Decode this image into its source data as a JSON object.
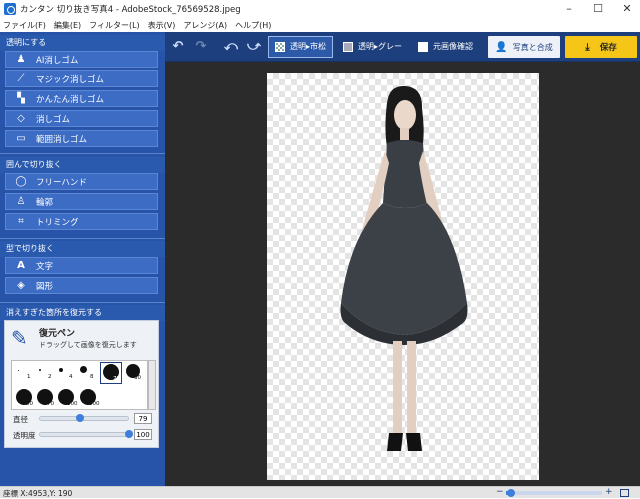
{
  "window": {
    "title": "カンタン 切り抜き写真4 - AdobeStock_76569528.jpeg",
    "minimize": "–",
    "maximize": "☐",
    "close": "✕"
  },
  "menu": [
    "ファイル(F)",
    "編集(E)",
    "フィルター(L)",
    "表示(V)",
    "アレンジ(A)",
    "ヘルプ(H)"
  ],
  "toolbar": {
    "undo": "↶",
    "redo": "↷",
    "rotate_left": "⤺",
    "rotate_right": "⤻",
    "modes": [
      {
        "label": "透明▸市松",
        "active": true
      },
      {
        "label": "透明▸グレー",
        "active": false
      },
      {
        "label": "元画像確認",
        "active": false
      }
    ],
    "compose_label": "写真と合成",
    "save_label": "保存"
  },
  "sidebar": {
    "transparent_header": "透明にする",
    "transparent_tools": [
      {
        "label": "AI消しゴム",
        "icon": "person-icon"
      },
      {
        "label": "マジック消しゴム",
        "icon": "magic-wand-icon"
      },
      {
        "label": "かんたん消しゴム",
        "icon": "easy-eraser-icon"
      },
      {
        "label": "消しゴム",
        "icon": "eraser-icon"
      },
      {
        "label": "範囲消しゴム",
        "icon": "rectangle-icon"
      }
    ],
    "enclose_header": "囲んで切り抜く",
    "enclose_tools": [
      {
        "label": "フリーハンド",
        "icon": "lasso-icon"
      },
      {
        "label": "輪郭",
        "icon": "person-outline-icon"
      },
      {
        "label": "トリミング",
        "icon": "crop-icon"
      }
    ],
    "shape_header": "型で切り抜く",
    "shape_tools": [
      {
        "label": "文字",
        "icon": "text-icon"
      },
      {
        "label": "図形",
        "icon": "shapes-icon"
      }
    ],
    "restore_header": "消えすぎた箇所を復元する",
    "restore": {
      "title": "復元ペン",
      "description": "ドラッグして画像を復元します",
      "brushes": [
        "1",
        "2",
        "4",
        "8",
        "79",
        "30",
        "50",
        "70",
        "100",
        "200"
      ],
      "selected_brush": "79",
      "size_label": "直径",
      "size_value": "79",
      "size_level": 0.45,
      "opacity_label": "透明度",
      "opacity_value": "100",
      "opacity_level": 1.0
    }
  },
  "status": {
    "coords": "座標 X:4953,Y: 190",
    "zoom_level": 0.05,
    "zoom_minus": "−",
    "zoom_plus": "+"
  }
}
